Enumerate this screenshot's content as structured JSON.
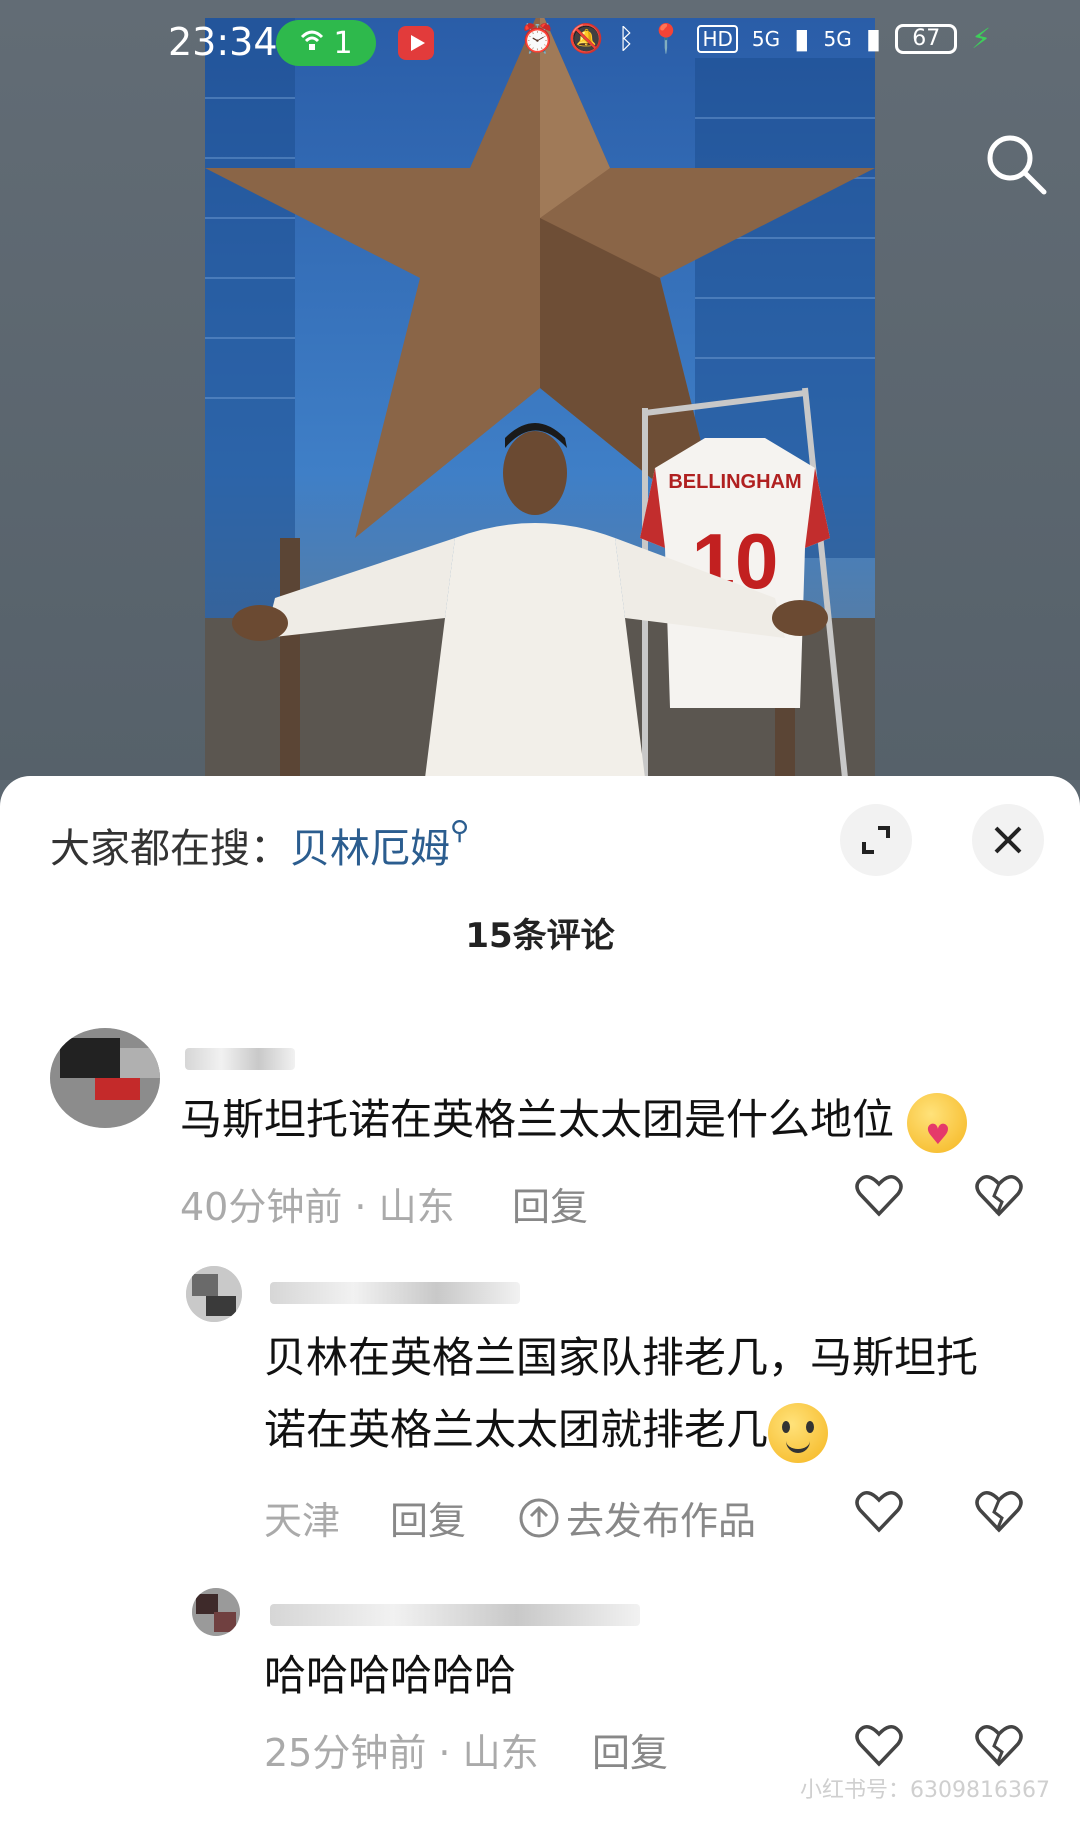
{
  "status": {
    "time": "23:34",
    "wifi_count": "1",
    "signal_a": "5G",
    "signal_b": "5G",
    "battery": "67"
  },
  "photo": {
    "jersey_name": "BELLINGHAM",
    "jersey_number": "10"
  },
  "sheet": {
    "hot_label": "大家都在搜：",
    "hot_keyword": "贝林厄姆",
    "comment_count": "15条评论"
  },
  "comments": [
    {
      "text": "马斯坦托诺在英格兰太太团是什么地位",
      "time": "40分钟前 · 山东",
      "reply": "回复"
    },
    {
      "text_line1": "贝林在英格兰国家队排老几，马斯坦托",
      "text_line2": "诺在英格兰太太团就排老几",
      "location": "天津",
      "reply": "回复",
      "publish": "去发布作品"
    },
    {
      "text": "哈哈哈哈哈哈",
      "time": "25分钟前 · 山东",
      "reply": "回复"
    }
  ],
  "watermark": "小红书号：6309816367",
  "icons": [
    "search-icon",
    "expand-icon",
    "close-icon",
    "heart-icon",
    "dislike-heart-icon",
    "upload-icon"
  ]
}
